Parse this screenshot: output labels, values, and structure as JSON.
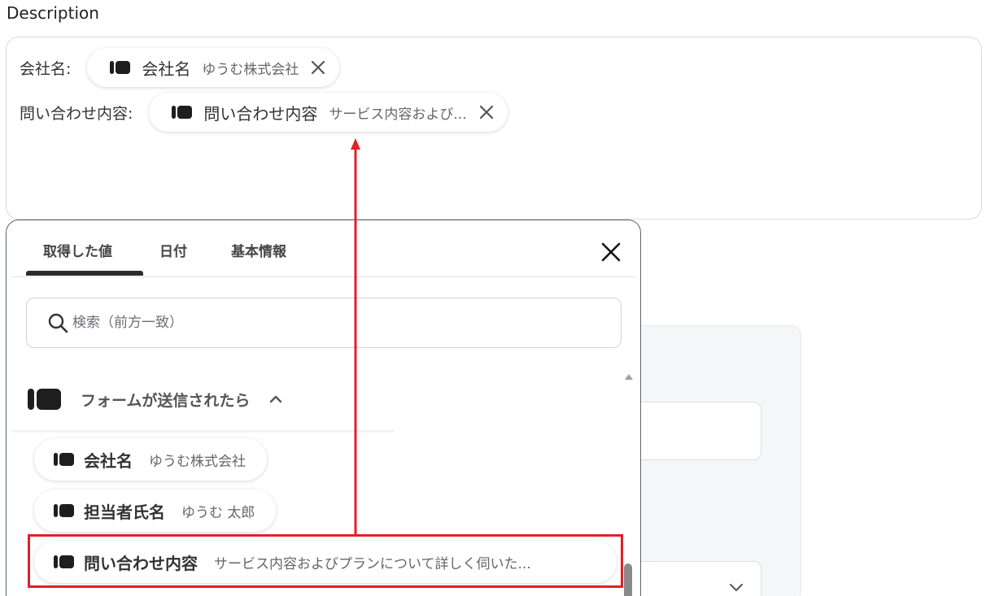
{
  "description": {
    "label": "Description",
    "fields": [
      {
        "label": "会社名:",
        "chip_name": "会社名",
        "chip_value": "ゆうむ株式会社"
      },
      {
        "label": "問い合わせ内容:",
        "chip_name": "問い合わせ内容",
        "chip_value": "サービス内容および..."
      }
    ]
  },
  "picker": {
    "tabs": [
      {
        "label": "取得した値",
        "active": true
      },
      {
        "label": "日付",
        "active": false
      },
      {
        "label": "基本情報",
        "active": false
      }
    ],
    "search_placeholder": "検索（前方一致）",
    "group_title": "フォームが送信されたら",
    "items": [
      {
        "name": "会社名",
        "value": "ゆうむ株式会社"
      },
      {
        "name": "担当者氏名",
        "value": "ゆうむ 太郎"
      },
      {
        "name": "問い合わせ内容",
        "value": "サービス内容およびプランについて詳しく伺いた...",
        "highlighted": true
      }
    ]
  },
  "colors": {
    "highlight": "#e0202a",
    "arrow": "#e0202a"
  },
  "icons": [
    "app-logo-icon",
    "close-icon",
    "search-icon",
    "chevron-up-icon",
    "chevron-down-icon",
    "scroll-up-icon"
  ]
}
